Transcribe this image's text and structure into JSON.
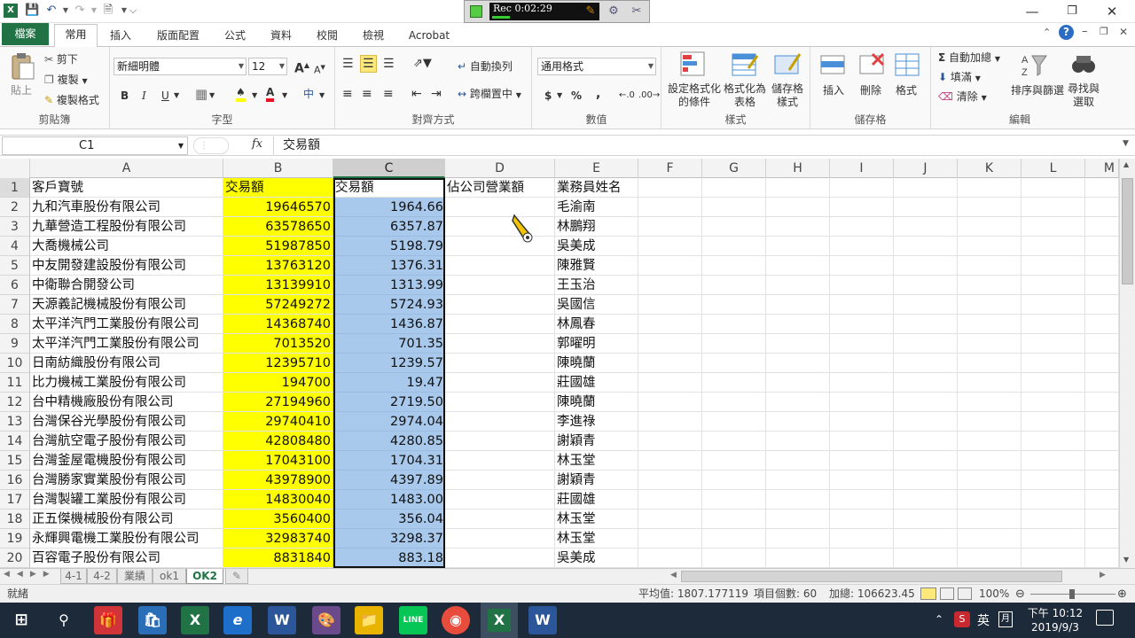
{
  "recorder": {
    "label": "Rec 0:02:29"
  },
  "ribbon_tabs": [
    "檔案",
    "常用",
    "插入",
    "版面配置",
    "公式",
    "資料",
    "校閱",
    "檢視",
    "Acrobat"
  ],
  "clipboard": {
    "paste": "貼上",
    "cut": "剪下",
    "copy": "複製",
    "format_painter": "複製格式",
    "label": "剪貼簿"
  },
  "font": {
    "name": "新細明體",
    "size": "12",
    "label": "字型",
    "bold": "B",
    "italic": "I",
    "underline": "U",
    "grow": "A",
    "shrink": "A"
  },
  "alignment": {
    "wrap": "自動換列",
    "merge": "跨欄置中",
    "label": "對齊方式"
  },
  "number": {
    "format": "通用格式",
    "currency": "$",
    "percent": "%",
    "comma": ",",
    "label": "數值"
  },
  "styles": {
    "conditional": "設定格式化的條件",
    "table": "格式化為表格",
    "cell": "儲存格樣式",
    "label": "樣式"
  },
  "cells": {
    "insert": "插入",
    "delete": "刪除",
    "format": "格式",
    "label": "儲存格"
  },
  "editing": {
    "autosum": "自動加總",
    "fill": "填滿",
    "clear": "清除",
    "sort": "排序與篩選",
    "find": "尋找與選取",
    "label": "編輯"
  },
  "formula_bar": {
    "name_box": "C1",
    "fx": "fx",
    "content": "交易額"
  },
  "columns": [
    "A",
    "B",
    "C",
    "D",
    "E",
    "F",
    "G",
    "H",
    "I",
    "J",
    "K",
    "L",
    "M"
  ],
  "rows": [
    {
      "n": "1",
      "a": "客戶寶號",
      "b": "交易額",
      "c": "交易額",
      "d": "佔公司營業額",
      "e": "業務員姓名"
    },
    {
      "n": "2",
      "a": "九和汽車股份有限公司",
      "b": "19646570",
      "c": "1964.66",
      "d": "",
      "e": "毛渝南"
    },
    {
      "n": "3",
      "a": "九華營造工程股份有限公司",
      "b": "63578650",
      "c": "6357.87",
      "d": "",
      "e": "林鵬翔"
    },
    {
      "n": "4",
      "a": "大喬機械公司",
      "b": "51987850",
      "c": "5198.79",
      "d": "",
      "e": "吳美成"
    },
    {
      "n": "5",
      "a": "中友開發建設股份有限公司",
      "b": "13763120",
      "c": "1376.31",
      "d": "",
      "e": "陳雅賢"
    },
    {
      "n": "6",
      "a": "中衛聯合開發公司",
      "b": "13139910",
      "c": "1313.99",
      "d": "",
      "e": "王玉治"
    },
    {
      "n": "7",
      "a": "天源義記機械股份有限公司",
      "b": "57249272",
      "c": "5724.93",
      "d": "",
      "e": "吳國信"
    },
    {
      "n": "8",
      "a": "太平洋汽門工業股份有限公司",
      "b": "14368740",
      "c": "1436.87",
      "d": "",
      "e": "林鳳春"
    },
    {
      "n": "9",
      "a": "太平洋汽門工業股份有限公司",
      "b": "7013520",
      "c": "701.35",
      "d": "",
      "e": "郭曜明"
    },
    {
      "n": "10",
      "a": "日南紡織股份有限公司",
      "b": "12395710",
      "c": "1239.57",
      "d": "",
      "e": "陳曉蘭"
    },
    {
      "n": "11",
      "a": "比力機械工業股份有限公司",
      "b": "194700",
      "c": "19.47",
      "d": "",
      "e": "莊國雄"
    },
    {
      "n": "12",
      "a": "台中精機廠股份有限公司",
      "b": "27194960",
      "c": "2719.50",
      "d": "",
      "e": "陳曉蘭"
    },
    {
      "n": "13",
      "a": "台灣保谷光學股份有限公司",
      "b": "29740410",
      "c": "2974.04",
      "d": "",
      "e": "李進祿"
    },
    {
      "n": "14",
      "a": "台灣航空電子股份有限公司",
      "b": "42808480",
      "c": "4280.85",
      "d": "",
      "e": "謝穎青"
    },
    {
      "n": "15",
      "a": "台灣釜屋電機股份有限公司",
      "b": "17043100",
      "c": "1704.31",
      "d": "",
      "e": "林玉堂"
    },
    {
      "n": "16",
      "a": "台灣勝家實業股份有限公司",
      "b": "43978900",
      "c": "4397.89",
      "d": "",
      "e": "謝穎青"
    },
    {
      "n": "17",
      "a": "台灣製罐工業股份有限公司",
      "b": "14830040",
      "c": "1483.00",
      "d": "",
      "e": "莊國雄"
    },
    {
      "n": "18",
      "a": "正五傑機械股份有限公司",
      "b": "3560400",
      "c": "356.04",
      "d": "",
      "e": "林玉堂"
    },
    {
      "n": "19",
      "a": "永輝興電機工業股份有限公司",
      "b": "32983740",
      "c": "3298.37",
      "d": "",
      "e": "林玉堂"
    },
    {
      "n": "20",
      "a": "百容電子股份有限公司",
      "b": "8831840",
      "c": "883.18",
      "d": "",
      "e": "吳美成"
    }
  ],
  "sheet_tabs": [
    "4-1",
    "4-2",
    "業績",
    "ok1",
    "OK2"
  ],
  "status": {
    "ready": "就緒",
    "average": "平均值: 1807.177119",
    "count": "項目個數: 60",
    "sum": "加總: 106623.45",
    "zoom": "100%"
  },
  "taskbar": {
    "ime": "英",
    "time": "下午 10:12",
    "date": "2019/9/3"
  },
  "colors": {
    "excel_green": "#217346",
    "highlight_yellow": "#ffff00",
    "selection_blue": "#a8c8ec"
  }
}
